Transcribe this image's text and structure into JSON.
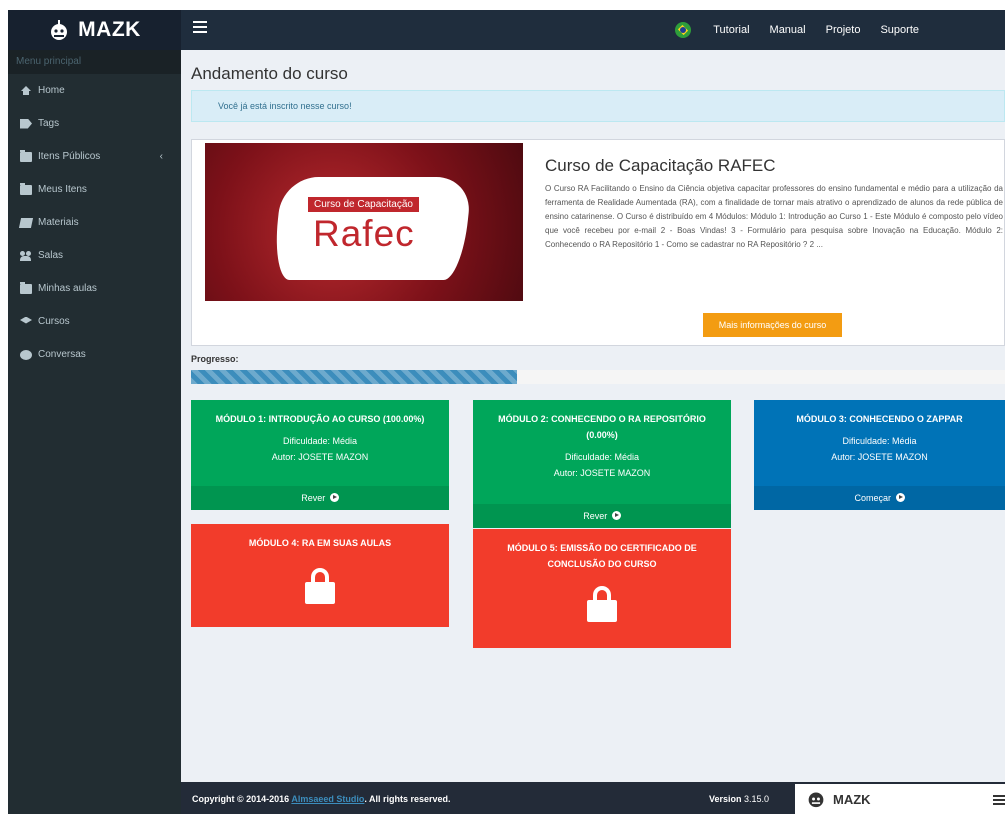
{
  "app": {
    "logo_text": "MAZK"
  },
  "topnav": {
    "items": [
      "Tutorial",
      "Manual",
      "Projeto",
      "Suporte"
    ]
  },
  "sidebar": {
    "header": "Menu principal",
    "items": [
      {
        "label": "Home",
        "icon": "home-icon"
      },
      {
        "label": "Tags",
        "icon": "tag-icon"
      },
      {
        "label": "Itens Públicos",
        "icon": "folder-icon"
      },
      {
        "label": "Meus Itens",
        "icon": "folder-icon"
      },
      {
        "label": "Materiais",
        "icon": "book-icon"
      },
      {
        "label": "Salas",
        "icon": "users-icon"
      },
      {
        "label": "Minhas aulas",
        "icon": "folder-icon"
      },
      {
        "label": "Cursos",
        "icon": "graduation-cap-icon"
      },
      {
        "label": "Conversas",
        "icon": "chat-icon"
      }
    ]
  },
  "main": {
    "title": "Andamento do curso",
    "alert": "Você já está inscrito nesse curso!",
    "course": {
      "banner_tag": "Curso de Capacitação",
      "banner_title": "Rafec",
      "title": "Curso de Capacitação RAFEC",
      "description": "O Curso RA Facilitando o Ensino da Ciência objetiva capacitar professores do ensino fundamental e médio para a utilização da ferramenta de Realidade Aumentada (RA), com a finalidade de tornar mais atrativo o aprendizado de alunos da rede pública de ensino catarinense. O Curso é distribuído em 4 Módulos: Módulo 1: Introdução ao Curso 1 - Este Módulo é composto pelo vídeo que você recebeu por e-mail 2 - Boas Vindas! 3 - Formulário para pesquisa sobre Inovação na Educação. Módulo 2: Conhecendo o RA Repositório 1 - Como se cadastrar no RA Repositório ? 2 ...",
      "more_button": "Mais informações do curso"
    },
    "progress": {
      "label": "Progresso:",
      "value_percent": 40
    },
    "modules": [
      {
        "title": "MÓDULO 1: INTRODUÇÃO AO CURSO (100.00%)",
        "difficulty": "Dificuldade: Média",
        "author": "Autor: JOSETE MAZON",
        "action": "Rever",
        "color": "#00a65a",
        "locked": false
      },
      {
        "title": "MÓDULO 2: CONHECENDO O RA REPOSITÓRIO (0.00%)",
        "difficulty": "Dificuldade: Média",
        "author": "Autor: JOSETE MAZON",
        "action": "Rever",
        "color": "#00a65a",
        "locked": false
      },
      {
        "title": "MÓDULO 3: CONHECENDO O ZAPPAR",
        "difficulty": "Dificuldade: Média",
        "author": "Autor: JOSETE MAZON",
        "action": "Começar",
        "color": "#0073b7",
        "locked": false
      },
      {
        "title": "MÓDULO 4: RA EM SUAS AULAS",
        "color": "#f23c2b",
        "locked": true
      },
      {
        "title": "MÓDULO 5: EMISSÃO DO CERTIFICADO DE CONCLUSÃO DO CURSO",
        "color": "#f23c2b",
        "locked": true
      }
    ]
  },
  "footer": {
    "copyright_prefix": "Copyright © 2014-2016",
    "studio": "Almsaeed Studio",
    "copyright_suffix": ". All rights reserved.",
    "version_label": "Version",
    "version": "3.15.0",
    "mini_logo": "MAZK"
  }
}
